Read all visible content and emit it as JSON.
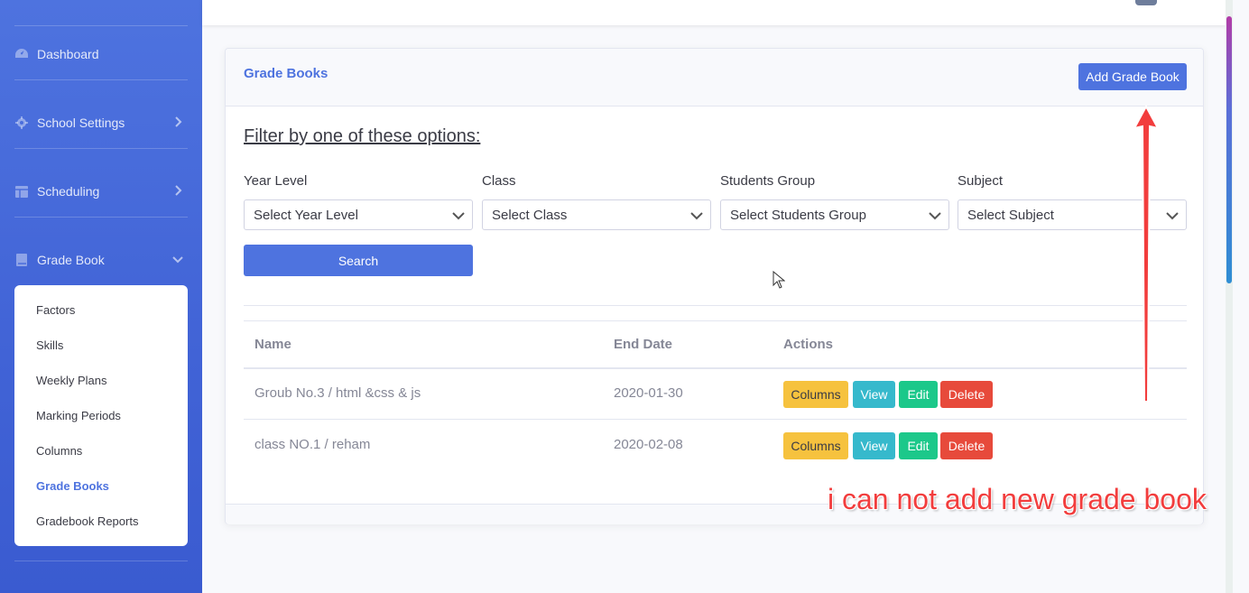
{
  "sidebar": {
    "items": [
      {
        "label": "Dashboard",
        "icon": "dashboard-icon",
        "has_chevron": false
      },
      {
        "label": "School Settings",
        "icon": "gear-icon",
        "has_chevron": true
      },
      {
        "label": "Scheduling",
        "icon": "table-icon",
        "has_chevron": true
      },
      {
        "label": "Grade Book",
        "icon": "book-icon",
        "has_chevron": true,
        "expanded": true
      }
    ],
    "submenu": [
      "Factors",
      "Skills",
      "Weekly Plans",
      "Marking Periods",
      "Columns",
      "Grade Books",
      "Gradebook Reports"
    ],
    "active_submenu": "Grade Books"
  },
  "card": {
    "title": "Grade Books",
    "add_button": "Add Grade Book"
  },
  "filter": {
    "heading": "Filter by one of these options:",
    "fields": [
      {
        "label": "Year Level",
        "selected": "Select Year Level"
      },
      {
        "label": "Class",
        "selected": "Select Class"
      },
      {
        "label": "Students Group",
        "selected": "Select Students Group"
      },
      {
        "label": "Subject",
        "selected": "Select Subject"
      }
    ],
    "search_button": "Search"
  },
  "table": {
    "headers": [
      "Name",
      "End Date",
      "Actions"
    ],
    "rows": [
      {
        "name": "Groub No.3 / html &css & js",
        "end_date": "2020-01-30"
      },
      {
        "name": "class NO.1 / reham",
        "end_date": "2020-02-08"
      }
    ],
    "actions": {
      "columns": "Columns",
      "view": "View",
      "edit": "Edit",
      "delete": "Delete"
    }
  },
  "annotation": {
    "text": "i can not add new grade book",
    "color": "#f23d3d"
  },
  "colors": {
    "primary": "#4e73df",
    "warning": "#f6c23e",
    "info": "#36b9cc",
    "success": "#1cc88a",
    "danger": "#e74a3b"
  }
}
